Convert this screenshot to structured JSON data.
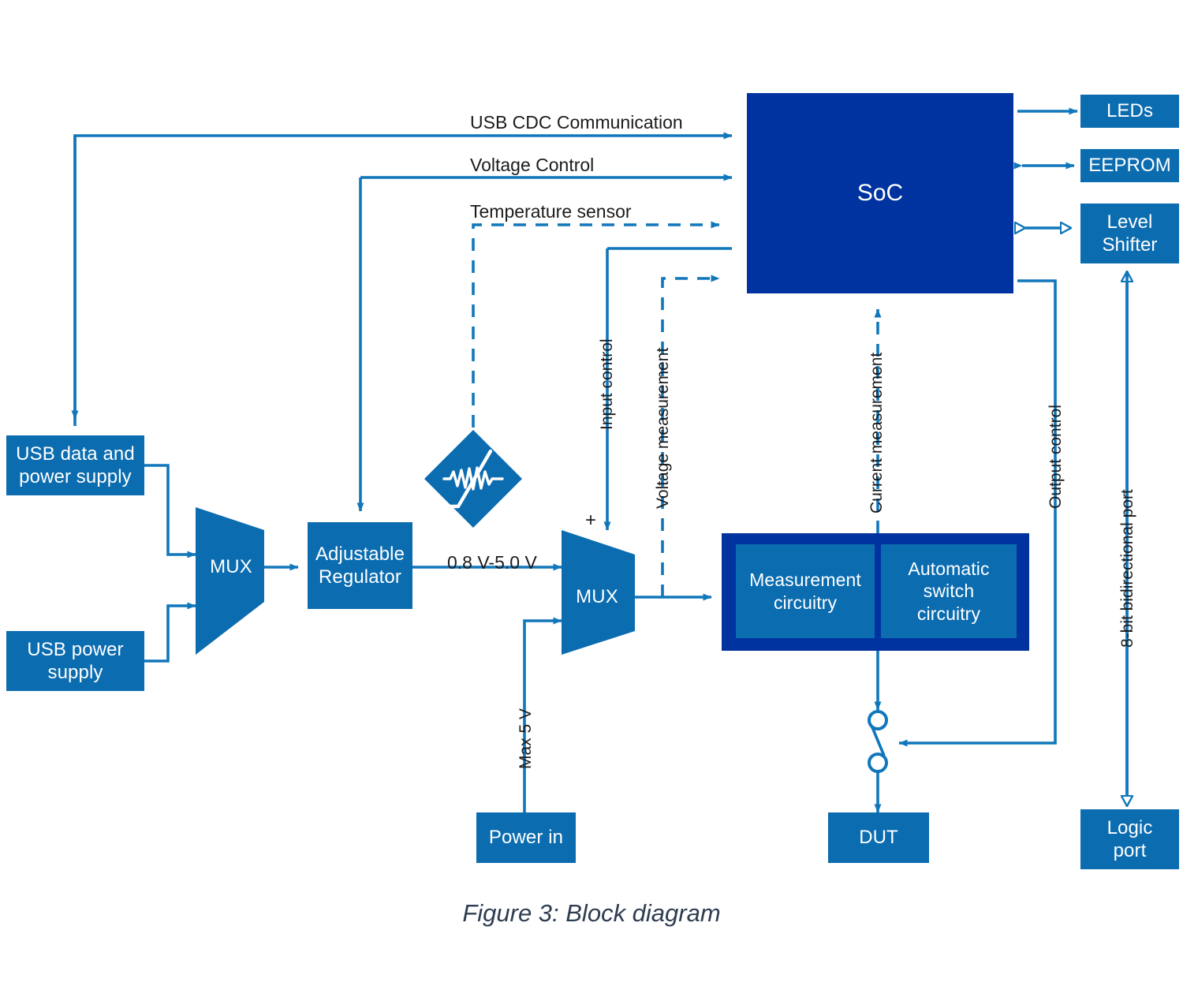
{
  "figure": {
    "caption": "Figure 3: Block diagram"
  },
  "palette": {
    "light_blue": "#0b6cb0",
    "dark_blue": "#0033a0",
    "line_blue": "#1177bb",
    "text_dark": "#1b1b1b",
    "caption_color": "#2e3c50",
    "background": "#ffffff"
  },
  "blocks": {
    "usb_data_power": "USB data and\npower supply",
    "usb_data_power_l1": "USB data and",
    "usb_data_power_l2": "power supply",
    "usb_power": "USB power\nsupply",
    "usb_power_l1": "USB power",
    "usb_power_l2": "supply",
    "mux_left": "MUX",
    "adjustable_regulator_l1": "Adjustable",
    "adjustable_regulator_l2": "Regulator",
    "mux_right": "MUX",
    "soc": "SoC",
    "leds": "LEDs",
    "eeprom": "EEPROM",
    "level_shifter_l1": "Level",
    "level_shifter_l2": "Shifter",
    "measurement_circuitry_l1": "Measurement",
    "measurement_circuitry_l2": "circuitry",
    "automatic_switch_l1": "Automatic",
    "automatic_switch_l2": "switch",
    "automatic_switch_l3": "circuitry",
    "dut": "DUT",
    "power_in": "Power in",
    "logic_port_l1": "Logic",
    "logic_port_l2": "port"
  },
  "signal_labels": {
    "usb_cdc": "USB CDC Communication",
    "voltage_control": "Voltage Control",
    "temperature_sensor": "Temperature sensor",
    "input_control": "Input control",
    "voltage_measurement": "Voltage measurement",
    "current_measurement": "Current measurement",
    "output_control": "Output control",
    "bidirectional_port": "8-bit bidirectional port",
    "voltage_range": "0.8 V-5.0 V",
    "max_voltage": "Max 5 V",
    "plus_sign": "+"
  },
  "icons": {
    "temperature_sensor_diamond": "thermistor-icon",
    "switch": "spdt-switch-icon"
  }
}
